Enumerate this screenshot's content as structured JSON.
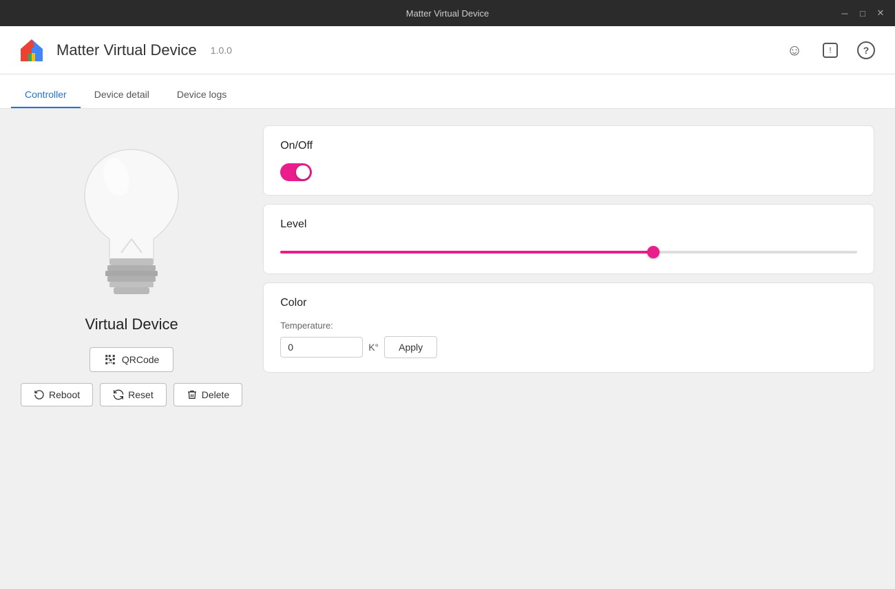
{
  "titlebar": {
    "title": "Matter Virtual Device",
    "minimize": "─",
    "maximize": "□",
    "close": "✕"
  },
  "header": {
    "app_title": "Matter Virtual Device",
    "app_version": "1.0.0",
    "emoji_icon": "☺",
    "alert_icon": "⊡",
    "help_icon": "?"
  },
  "tabs": [
    {
      "id": "controller",
      "label": "Controller",
      "active": true
    },
    {
      "id": "device-detail",
      "label": "Device detail",
      "active": false
    },
    {
      "id": "device-logs",
      "label": "Device logs",
      "active": false
    }
  ],
  "left_panel": {
    "device_name": "Virtual Device",
    "qrcode_button": "QRCode",
    "reboot_button": "Reboot",
    "reset_button": "Reset",
    "delete_button": "Delete"
  },
  "controls": {
    "on_off": {
      "title": "On/Off",
      "value": true
    },
    "level": {
      "title": "Level",
      "value": 65,
      "min": 0,
      "max": 100
    },
    "color": {
      "title": "Color",
      "temperature_label": "Temperature:",
      "temperature_value": "0",
      "temperature_unit": "K°",
      "apply_label": "Apply"
    }
  }
}
